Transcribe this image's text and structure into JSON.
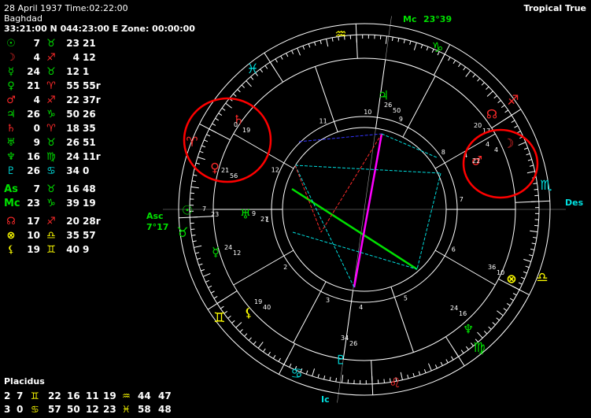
{
  "header": {
    "date_time": "28 April 1937 Time:02:22:00",
    "place": "Baghdad",
    "coords": "33:21:00 N 044:23:00 E Zone: 00:00:00",
    "mode": "Tropical True"
  },
  "positions": [
    {
      "glyph": "☉",
      "color": "#00e000",
      "deg": "7",
      "sign": "♉",
      "signColor": "#00e000",
      "min": "23",
      "sec": "21"
    },
    {
      "glyph": "☽",
      "color": "#ff2a2a",
      "deg": "4",
      "sign": "♐",
      "signColor": "#ff2a2a",
      "min": "4",
      "sec": "12"
    },
    {
      "glyph": "☿",
      "color": "#00e000",
      "deg": "24",
      "sign": "♉",
      "signColor": "#00e000",
      "min": "12",
      "sec": "1"
    },
    {
      "glyph": "♀",
      "color": "#00e000",
      "deg": "21",
      "sign": "♈",
      "signColor": "#ff2a2a",
      "min": "55",
      "sec": "55r"
    },
    {
      "glyph": "♂",
      "color": "#ff2a2a",
      "deg": "4",
      "sign": "♐",
      "signColor": "#ff2a2a",
      "min": "22",
      "sec": "37r"
    },
    {
      "glyph": "♃",
      "color": "#00e000",
      "deg": "26",
      "sign": "♑",
      "signColor": "#00e000",
      "min": "50",
      "sec": "26"
    },
    {
      "glyph": "♄",
      "color": "#ff2a2a",
      "deg": "0",
      "sign": "♈",
      "signColor": "#ff2a2a",
      "min": "18",
      "sec": "35"
    },
    {
      "glyph": "♅",
      "color": "#00e000",
      "deg": "9",
      "sign": "♉",
      "signColor": "#00e000",
      "min": "26",
      "sec": "51"
    },
    {
      "glyph": "♆",
      "color": "#00e000",
      "deg": "16",
      "sign": "♍",
      "signColor": "#00e000",
      "min": "24",
      "sec": "11r"
    },
    {
      "glyph": "♇",
      "color": "#00e0e0",
      "deg": "26",
      "sign": "♋",
      "signColor": "#00e0e0",
      "min": "34",
      "sec": "0"
    },
    {
      "glyph": "As",
      "color": "#00e000",
      "deg": "7",
      "sign": "♉",
      "signColor": "#00e000",
      "min": "16",
      "sec": "48"
    },
    {
      "glyph": "Mc",
      "color": "#00e000",
      "deg": "23",
      "sign": "♑",
      "signColor": "#00e000",
      "min": "39",
      "sec": "19"
    },
    {
      "glyph": "☊",
      "color": "#ff2a2a",
      "deg": "17",
      "sign": "♐",
      "signColor": "#ff2a2a",
      "min": "20",
      "sec": "28r"
    },
    {
      "glyph": "⊗",
      "color": "#ffff00",
      "deg": "10",
      "sign": "♎",
      "signColor": "#ffff00",
      "min": "35",
      "sec": "57"
    },
    {
      "glyph": "⚸",
      "color": "#ffff00",
      "deg": "19",
      "sign": "♊",
      "signColor": "#ffff00",
      "min": "40",
      "sec": "9"
    }
  ],
  "placidus_label": "Placidus",
  "houses_rows": [
    [
      "2",
      "7",
      "♊",
      "22",
      "16",
      "11",
      "19",
      "♒",
      "44",
      "47"
    ],
    [
      "3",
      "0",
      "♋",
      "57",
      "50",
      "12",
      "23",
      "♓",
      "58",
      "48"
    ]
  ],
  "chart": {
    "axis_labels": {
      "asc": "Asc",
      "asc_pos": "7°17",
      "mc": "Mc",
      "mc_pos": "23°39",
      "des": "Des",
      "ic": "Ic"
    },
    "house_numbers": [
      "1",
      "2",
      "3",
      "4",
      "5",
      "6",
      "7",
      "8",
      "9",
      "10",
      "11",
      "12"
    ],
    "zodiac_glyphs": [
      "♒",
      "♑",
      "♐",
      "♏",
      "♎",
      "♍",
      "♌",
      "♋",
      "♊",
      "♉",
      "♈",
      "♓"
    ],
    "planet_labels": [
      {
        "glyph": "♃",
        "color": "#00e000",
        "deg": "26",
        "min": "50"
      },
      {
        "glyph": "☊",
        "color": "#ff2a2a",
        "deg": "20",
        "min": "17"
      },
      {
        "glyph": "☽",
        "color": "#ff2a2a",
        "deg": "4",
        "min": "4"
      },
      {
        "glyph": "♂",
        "color": "#ff2a2a",
        "deg": "4",
        "min": "22"
      },
      {
        "glyph": "♄",
        "color": "#ff2a2a",
        "deg": "0",
        "min": "19"
      },
      {
        "glyph": "♀",
        "color": "#ff2a2a",
        "deg": "21",
        "min": "56"
      },
      {
        "glyph": "☉",
        "color": "#00e000",
        "deg": "7",
        "min": "23"
      },
      {
        "glyph": "♅",
        "color": "#00e000",
        "deg": "9",
        "min": "27"
      },
      {
        "glyph": "☿",
        "color": "#00e000",
        "deg": "24",
        "min": "12"
      },
      {
        "glyph": "⚸",
        "color": "#ffff00",
        "deg": "19",
        "min": "40"
      },
      {
        "glyph": "♇",
        "color": "#00e0e0",
        "deg": "34",
        "min": "26"
      },
      {
        "glyph": "♆",
        "color": "#00e000",
        "deg": "24",
        "min": "16"
      },
      {
        "glyph": "⊗",
        "color": "#ffff00",
        "deg": "36",
        "min": "10"
      }
    ]
  },
  "colors": {
    "green": "#00e000",
    "red": "#ff2a2a",
    "cyan": "#00e0e0",
    "yellow": "#ffff00",
    "magenta": "#ff00ff",
    "blue": "#3333ff",
    "highlight": "#ff0000"
  }
}
